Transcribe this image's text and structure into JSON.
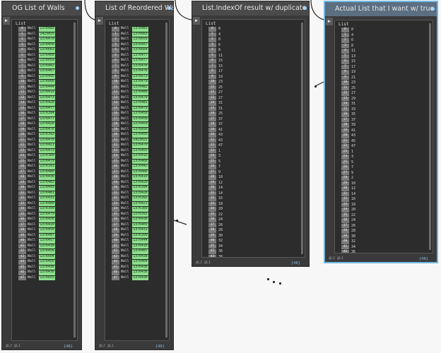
{
  "ui": {
    "list_title": "List",
    "levels_label": "@L2 @L1",
    "count_label": "{48}",
    "wall_label": "Wall",
    "input_arrow": "▶"
  },
  "nodes": [
    {
      "title": "OG List of Walls",
      "selected": false,
      "kind": "walls",
      "items": [
        "1376483",
        "1423025",
        "1376470",
        "1376456",
        "1376663",
        "1376460",
        "1376059",
        "1376442",
        "1376467",
        "1376495",
        "1376666",
        "1376444",
        "1376419",
        "1376473",
        "1376420",
        "1376477",
        "1376394",
        "1376477",
        "1376426",
        "1376476",
        "1376392",
        "1376476",
        "1376421",
        "1376473",
        "1376389",
        "1376479",
        "1376391",
        "1376480",
        "1376436",
        "1376482",
        "1376403",
        "1376481",
        "1376431",
        "1376480",
        "1376399",
        "1376479",
        "1376458",
        "1376410",
        "1376450",
        "1376407",
        "1376457",
        "1376438",
        "1376456",
        "1376604",
        "1376456",
        "1376436",
        "1376436",
        "1376655"
      ]
    },
    {
      "title": "List of Reordered Walls",
      "selected": false,
      "kind": "walls",
      "items": [
        "1376483",
        "1376663",
        "1376659",
        "1376457",
        "1376664",
        "1376477",
        "1376477",
        "1376476",
        "1376476",
        "1376673",
        "1376479",
        "1376482",
        "1376480",
        "1376479",
        "1376481",
        "1376479",
        "1376458",
        "1376458",
        "1376459",
        "1376656",
        "1376456",
        "1423025",
        "1376470",
        "1376455",
        "1376416",
        "1376460",
        "1376442",
        "1376666",
        "1376419",
        "1376420",
        "1376394",
        "1376426",
        "1376392",
        "1376421",
        "1376389",
        "1376391",
        "1376436",
        "1376403",
        "1376431",
        "1376399",
        "1376444",
        "1376410",
        "1376407",
        "1376438",
        "1376464",
        "1376436",
        "1376436",
        "1376436"
      ]
    },
    {
      "title": "List.IndexOf result w/ duplicate index values",
      "selected": false,
      "kind": "numbers",
      "items": [
        "0",
        "4",
        "8",
        "6",
        "8",
        "11",
        "15",
        "15",
        "17",
        "19",
        "23",
        "25",
        "27",
        "27",
        "31",
        "31",
        "25",
        "37",
        "37",
        "41",
        "43",
        "43",
        "47",
        "1",
        "3",
        "5",
        "7",
        "9",
        "10",
        "12",
        "14",
        "14",
        "16",
        "18",
        "20",
        "22",
        "24",
        "26",
        "28",
        "30",
        "32",
        "34",
        "36",
        "38",
        "40",
        "42",
        "44",
        "46"
      ]
    },
    {
      "title": "Actual List that I want w/ true index values",
      "selected": true,
      "kind": "numbers",
      "items": [
        "0",
        "4",
        "6",
        "8",
        "11",
        "13",
        "15",
        "17",
        "19",
        "21",
        "23",
        "25",
        "27",
        "29",
        "31",
        "33",
        "35",
        "37",
        "39",
        "41",
        "43",
        "45",
        "47",
        "1",
        "3",
        "5",
        "7",
        "9",
        "2",
        "10",
        "12",
        "14",
        "16",
        "18",
        "20",
        "22",
        "24",
        "26",
        "28",
        "30",
        "32",
        "34",
        "36",
        "38",
        "40",
        "42",
        "44",
        "46"
      ]
    }
  ]
}
